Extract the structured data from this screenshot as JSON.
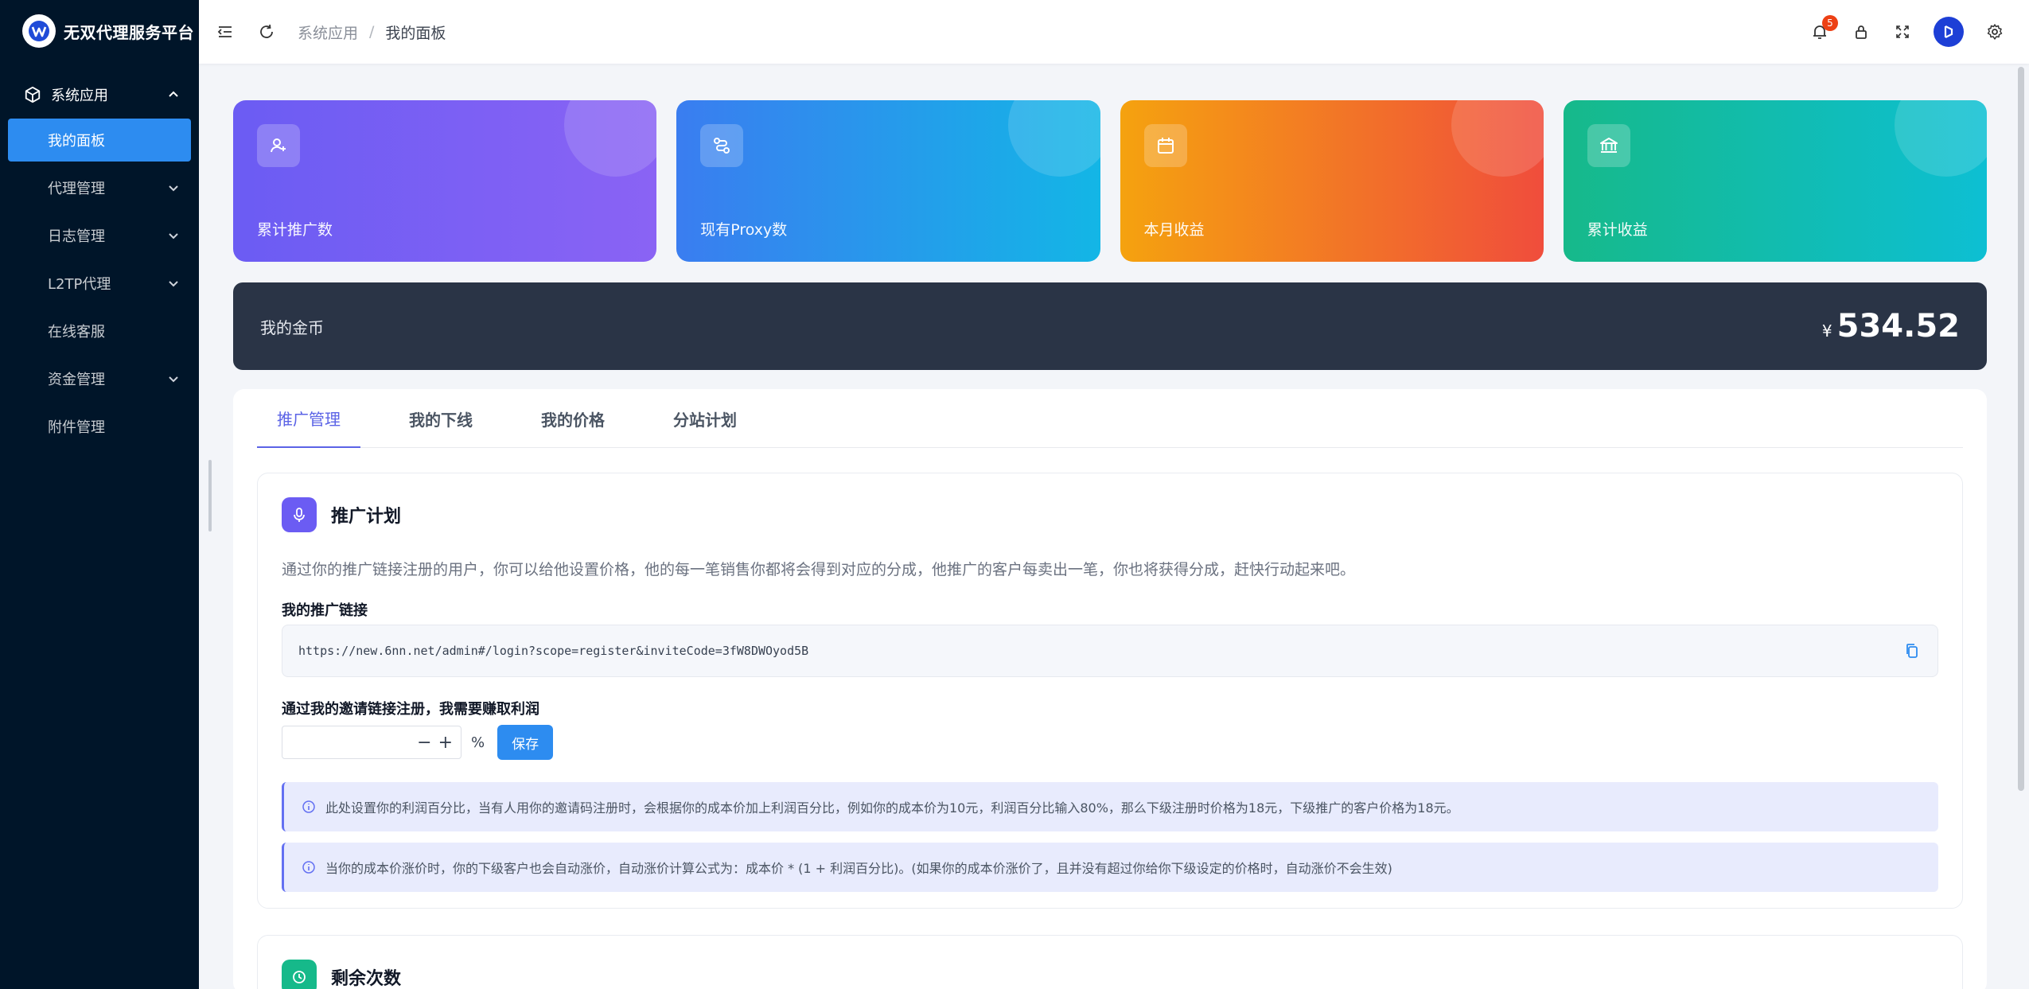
{
  "app": {
    "title": "无双代理服务平台"
  },
  "sidebar": {
    "group": {
      "label": "系统应用"
    },
    "items": [
      {
        "label": "我的面板",
        "active": true,
        "expandable": false
      },
      {
        "label": "代理管理",
        "expandable": true
      },
      {
        "label": "日志管理",
        "expandable": true
      },
      {
        "label": "L2TP代理",
        "expandable": true
      },
      {
        "label": "在线客服",
        "expandable": false
      },
      {
        "label": "资金管理",
        "expandable": true
      },
      {
        "label": "附件管理",
        "expandable": false
      }
    ]
  },
  "header": {
    "breadcrumb": [
      "系统应用",
      "我的面板"
    ],
    "notification_count": "5"
  },
  "stats": [
    {
      "label": "累计推广数",
      "icon": "user-plus-icon"
    },
    {
      "label": "现有Proxy数",
      "icon": "route-icon"
    },
    {
      "label": "本月收益",
      "icon": "calendar-icon"
    },
    {
      "label": "累计收益",
      "icon": "bank-icon"
    }
  ],
  "gold": {
    "label": "我的金币",
    "currency": "¥",
    "value": "534.52"
  },
  "tabs": [
    "推广管理",
    "我的下线",
    "我的价格",
    "分站计划"
  ],
  "promo": {
    "title": "推广计划",
    "description": "通过你的推广链接注册的用户，你可以给他设置价格，他的每一笔销售你都将会得到对应的分成，他推广的客户每卖出一笔，你也将获得分成，赶快行动起来吧。",
    "link_label": "我的推广链接",
    "link_url": "https://new.6nn.net/admin#/login?scope=register&inviteCode=3fW8DWOyod5B",
    "profit_label": "通过我的邀请链接注册，我需要赚取利润",
    "percent_sign": "%",
    "save_label": "保存",
    "notes": [
      "此处设置你的利润百分比，当有人用你的邀请码注册时，会根据你的成本价加上利润百分比，例如你的成本价为10元，利润百分比输入80%，那么下级注册时价格为18元，下级推广的客户价格为18元。",
      "当你的成本价涨价时，你的下级客户也会自动涨价，自动涨价计算公式为：成本价 * (1 + 利润百分比)。(如果你的成本价涨价了，且并没有超过你给你下级设定的价格时，自动涨价不会生效)"
    ]
  },
  "remaining": {
    "title": "剩余次数"
  },
  "colors": {
    "sidebar_bg": "#001529",
    "accent_blue": "#2d8cf0",
    "tab_active": "#5b63e6",
    "gold_banner": "#2a3446"
  }
}
